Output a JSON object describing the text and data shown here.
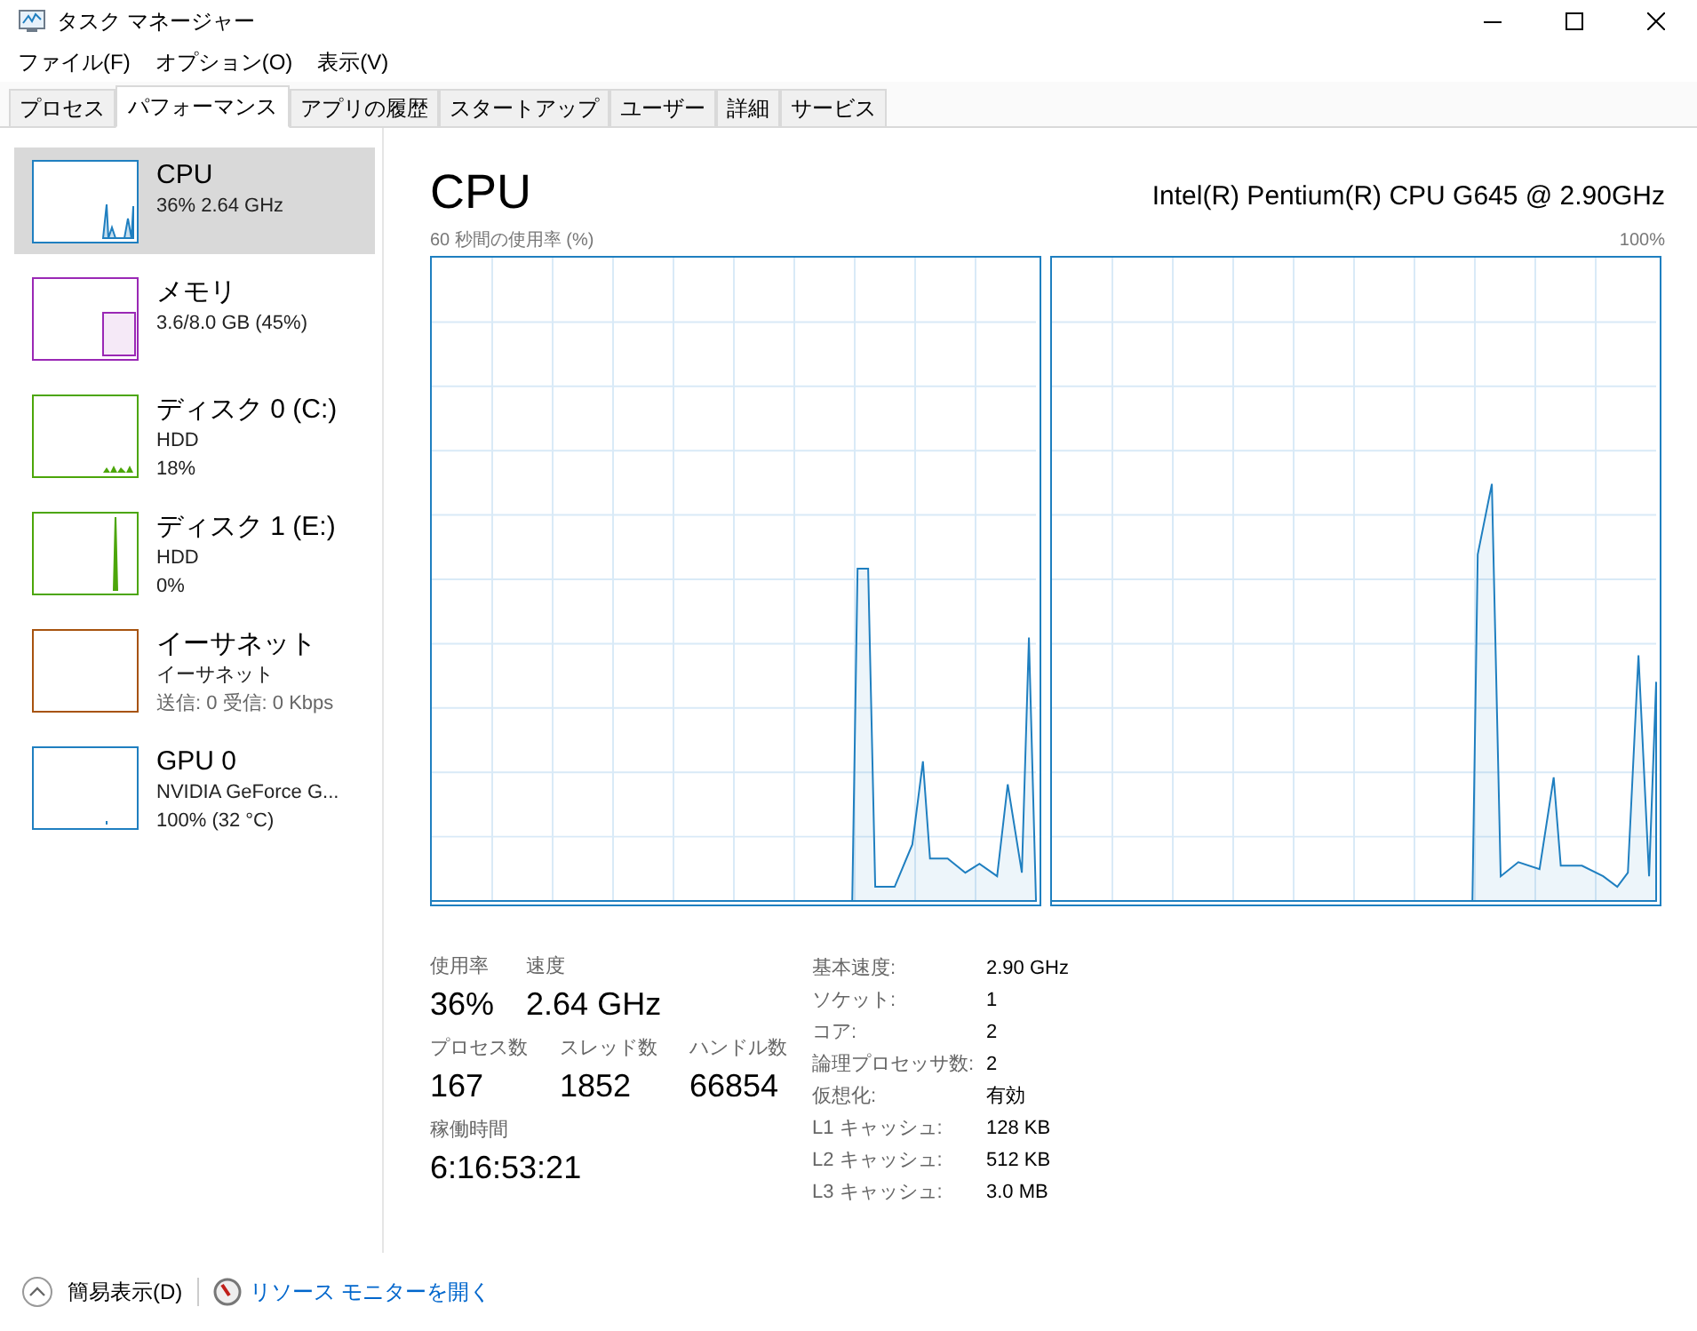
{
  "window": {
    "title": "タスク マネージャー"
  },
  "menu": [
    "ファイル(F)",
    "オプション(O)",
    "表示(V)"
  ],
  "tabs": [
    {
      "label": "プロセス",
      "selected": false
    },
    {
      "label": "パフォーマンス",
      "selected": true
    },
    {
      "label": "アプリの履歴",
      "selected": false
    },
    {
      "label": "スタートアップ",
      "selected": false
    },
    {
      "label": "ユーザー",
      "selected": false
    },
    {
      "label": "詳細",
      "selected": false
    },
    {
      "label": "サービス",
      "selected": false
    }
  ],
  "sidebar": {
    "items": [
      {
        "kind": "cpu",
        "title": "CPU",
        "lines": [
          "36%  2.64 GHz"
        ],
        "color": "#1f7fc0",
        "selected": true
      },
      {
        "kind": "memory",
        "title": "メモリ",
        "lines": [
          "3.6/8.0 GB (45%)"
        ],
        "color": "#9a28b5",
        "selected": false
      },
      {
        "kind": "disk",
        "title": "ディスク 0 (C:)",
        "lines": [
          "HDD",
          "18%"
        ],
        "color": "#4ca60a",
        "selected": false
      },
      {
        "kind": "disk-spike",
        "title": "ディスク 1 (E:)",
        "lines": [
          "HDD",
          "0%"
        ],
        "color": "#4ca60a",
        "selected": false
      },
      {
        "kind": "network",
        "title": "イーサネット",
        "lines": [
          "イーサネット",
          "送信: 0 受信: 0 Kbps"
        ],
        "color": "#a7530f",
        "selected": false
      },
      {
        "kind": "gpu",
        "title": "GPU 0",
        "lines": [
          "NVIDIA GeForce G...",
          "100% (32 °C)"
        ],
        "color": "#1f7fc0",
        "selected": false
      }
    ]
  },
  "main": {
    "title": "CPU",
    "model": "Intel(R) Pentium(R) CPU G645 @ 2.90GHz",
    "graph_caption": "60 秒間の使用率 (%)",
    "graph_max": "100%",
    "stats": [
      [
        {
          "label": "使用率",
          "value": "36%"
        },
        {
          "label": "速度",
          "value": "2.64 GHz"
        }
      ],
      [
        {
          "label": "プロセス数",
          "value": "167"
        },
        {
          "label": "スレッド数",
          "value": "1852"
        },
        {
          "label": "ハンドル数",
          "value": "66854"
        }
      ],
      [
        {
          "label": "稼働時間",
          "value": "6:16:53:21"
        }
      ]
    ],
    "details": [
      {
        "label": "基本速度:",
        "value": "2.90 GHz"
      },
      {
        "label": "ソケット:",
        "value": "1"
      },
      {
        "label": "コア:",
        "value": "2"
      },
      {
        "label": "論理プロセッサ数:",
        "value": "2"
      },
      {
        "label": "仮想化:",
        "value": "有効"
      },
      {
        "label": "L1 キャッシュ:",
        "value": "128 KB"
      },
      {
        "label": "L2 キャッシュ:",
        "value": "512 KB"
      },
      {
        "label": "L3 キャッシュ:",
        "value": "3.0 MB"
      }
    ]
  },
  "footer": {
    "fewer_details": "簡易表示(D)",
    "resource_monitor": "リソース モニターを開く"
  }
}
